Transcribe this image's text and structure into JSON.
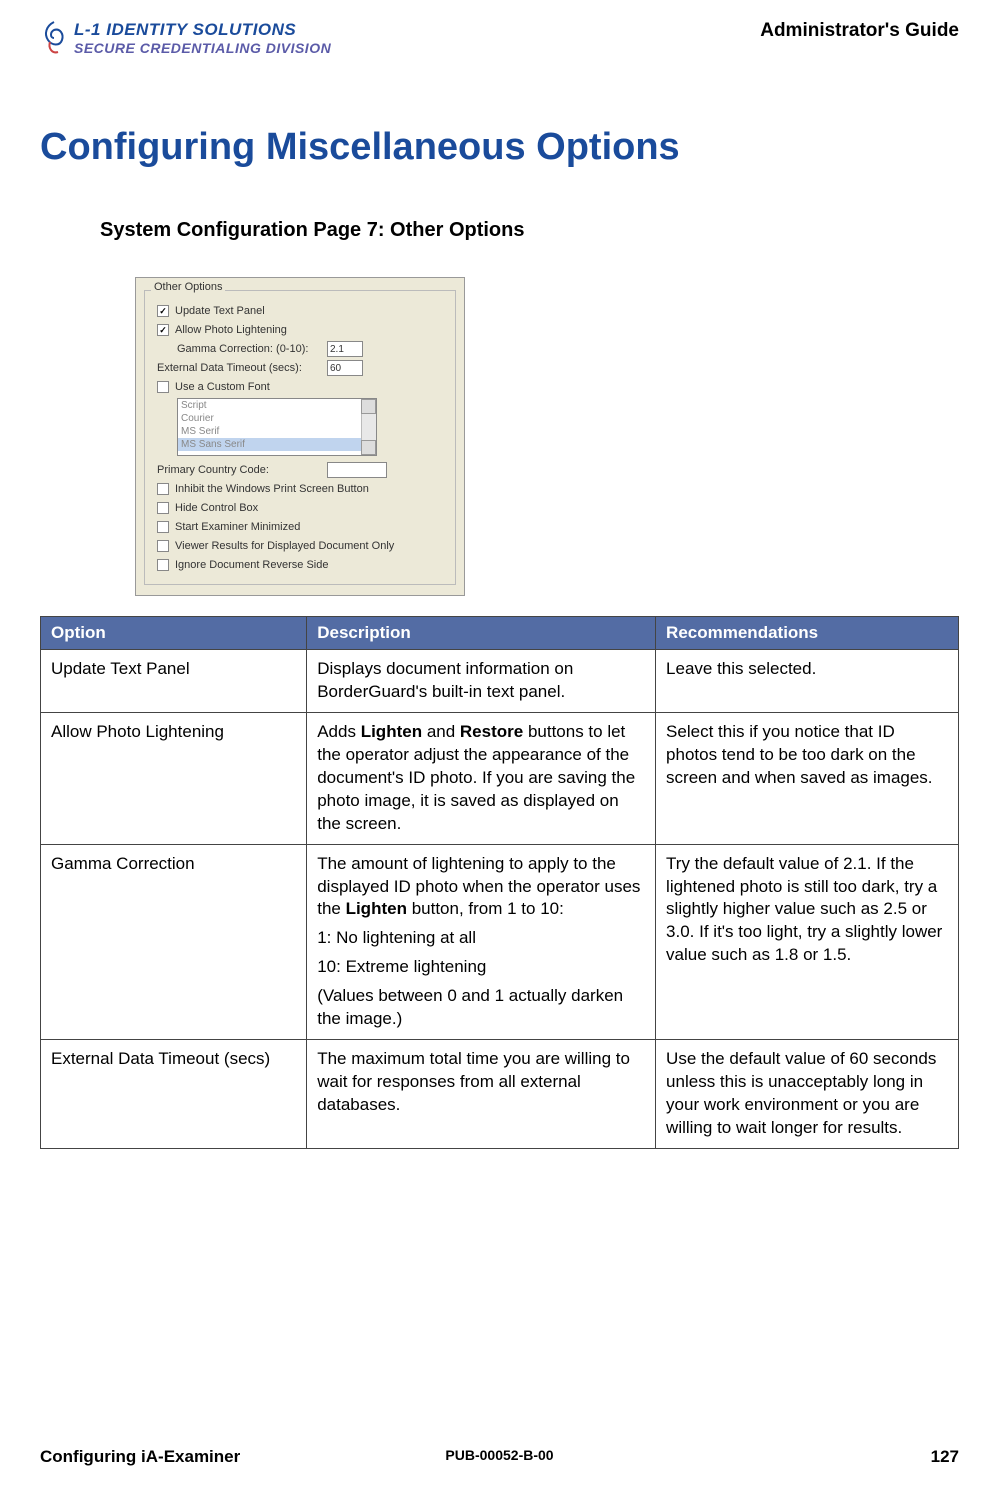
{
  "header": {
    "logo_line1": "L-1 IDENTITY SOLUTIONS",
    "logo_line2": "SECURE CREDENTIALING DIVISION",
    "guide_title": "Administrator's Guide"
  },
  "page_title": "Configuring Miscellaneous Options",
  "section_heading": "System Configuration Page 7: Other Options",
  "panel": {
    "legend": "Other Options",
    "update_text_panel": "Update Text Panel",
    "allow_photo_lightening": "Allow Photo Lightening",
    "gamma_label": "Gamma Correction: (0-10):",
    "gamma_value": "2.1",
    "ext_timeout_label": "External Data Timeout (secs):",
    "ext_timeout_value": "60",
    "use_custom_font": "Use a Custom Font",
    "fonts": [
      "Script",
      "Courier",
      "MS Serif",
      "MS Sans Serif"
    ],
    "primary_country": "Primary Country Code:",
    "inhibit_print": "Inhibit the Windows Print Screen Button",
    "hide_control_box": "Hide Control Box",
    "start_minimized": "Start Examiner Minimized",
    "viewer_results": "Viewer Results for Displayed Document Only",
    "ignore_reverse": "Ignore Document Reverse Side"
  },
  "table": {
    "headers": {
      "option": "Option",
      "description": "Description",
      "recommendations": "Recommendations"
    },
    "rows": [
      {
        "option": "Update Text Panel",
        "description": "Displays document information on BorderGuard's built-in text panel.",
        "recommendation": "Leave this selected."
      },
      {
        "option": "Allow Photo Lightening",
        "description_html": "Adds <b>Lighten</b> and <b>Restore</b> buttons to let the operator adjust the appearance of the document's ID photo. If you are saving the photo image, it is saved as displayed on the screen.",
        "recommendation": "Select this if you notice that ID photos tend to be too dark on the screen and when saved as images."
      },
      {
        "option": "Gamma Correction",
        "description_paras": [
          "The amount of lightening to apply to the displayed ID photo when the operator uses the <b>Lighten</b> button, from 1 to 10:",
          "1: No lightening at all",
          "10: Extreme lightening",
          "(Values between 0 and 1 actually darken the image.)"
        ],
        "recommendation": "Try the default value of 2.1. If the lightened photo is still too dark, try a slightly higher value such as 2.5 or 3.0. If it's too light, try a slightly lower value such as 1.8 or 1.5."
      },
      {
        "option": "External Data Timeout (secs)",
        "description": "The maximum total time you are willing to wait for responses from all external databases.",
        "recommendation": "Use the default value of 60 seconds unless this is unacceptably long in your work environment or you are willing to wait longer for results."
      }
    ]
  },
  "footer": {
    "left": "Configuring iA-Examiner",
    "center": "PUB-00052-B-00",
    "right": "127"
  }
}
